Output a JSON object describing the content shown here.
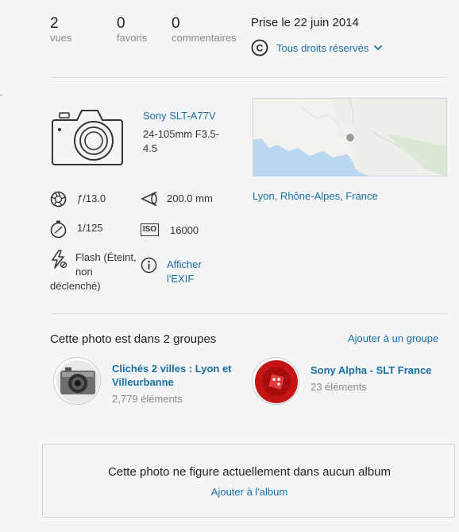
{
  "stats": [
    {
      "value": "2",
      "label": "vues"
    },
    {
      "value": "0",
      "label": "favoris"
    },
    {
      "value": "0",
      "label": "commentaires"
    }
  ],
  "date_taken": "Prise le 22 juin 2014",
  "license": {
    "icon": "copyright-icon",
    "label": "Tous droits réservés"
  },
  "camera": {
    "model": "Sony SLT-A77V",
    "lens_line1": "24-105mm F3.5-",
    "lens_line2": "4.5"
  },
  "exif": {
    "aperture": "ƒ/13.0",
    "focal_length": "200.0 mm",
    "shutter": "1/125",
    "iso_badge": "ISO",
    "iso": "16000",
    "flash_line1": "Flash (Éteint,",
    "flash_line2": "non",
    "flash_line3": "déclenché)",
    "show_exif_line1": "Afficher",
    "show_exif_line2": "l'EXIF"
  },
  "location": "Lyon, Rhône-Alpes, France",
  "groups": {
    "heading": "Cette photo est dans 2 groupes",
    "add_link": "Ajouter à un groupe",
    "items": [
      {
        "name_line1": "Clichés 2 villes : Lyon et",
        "name_line2": "Villeurbanne",
        "count": "2,779 éléments"
      },
      {
        "name_line1": "Sony Alpha - SLT France",
        "name_line2": "",
        "count": "23 éléments"
      }
    ]
  },
  "album": {
    "message": "Cette photo ne figure actuellement dans aucun album",
    "add_link": "Ajouter à l'album"
  },
  "colors": {
    "link": "#1a6fa5",
    "background": "#f3f5f6",
    "divider": "#d8dadc"
  }
}
